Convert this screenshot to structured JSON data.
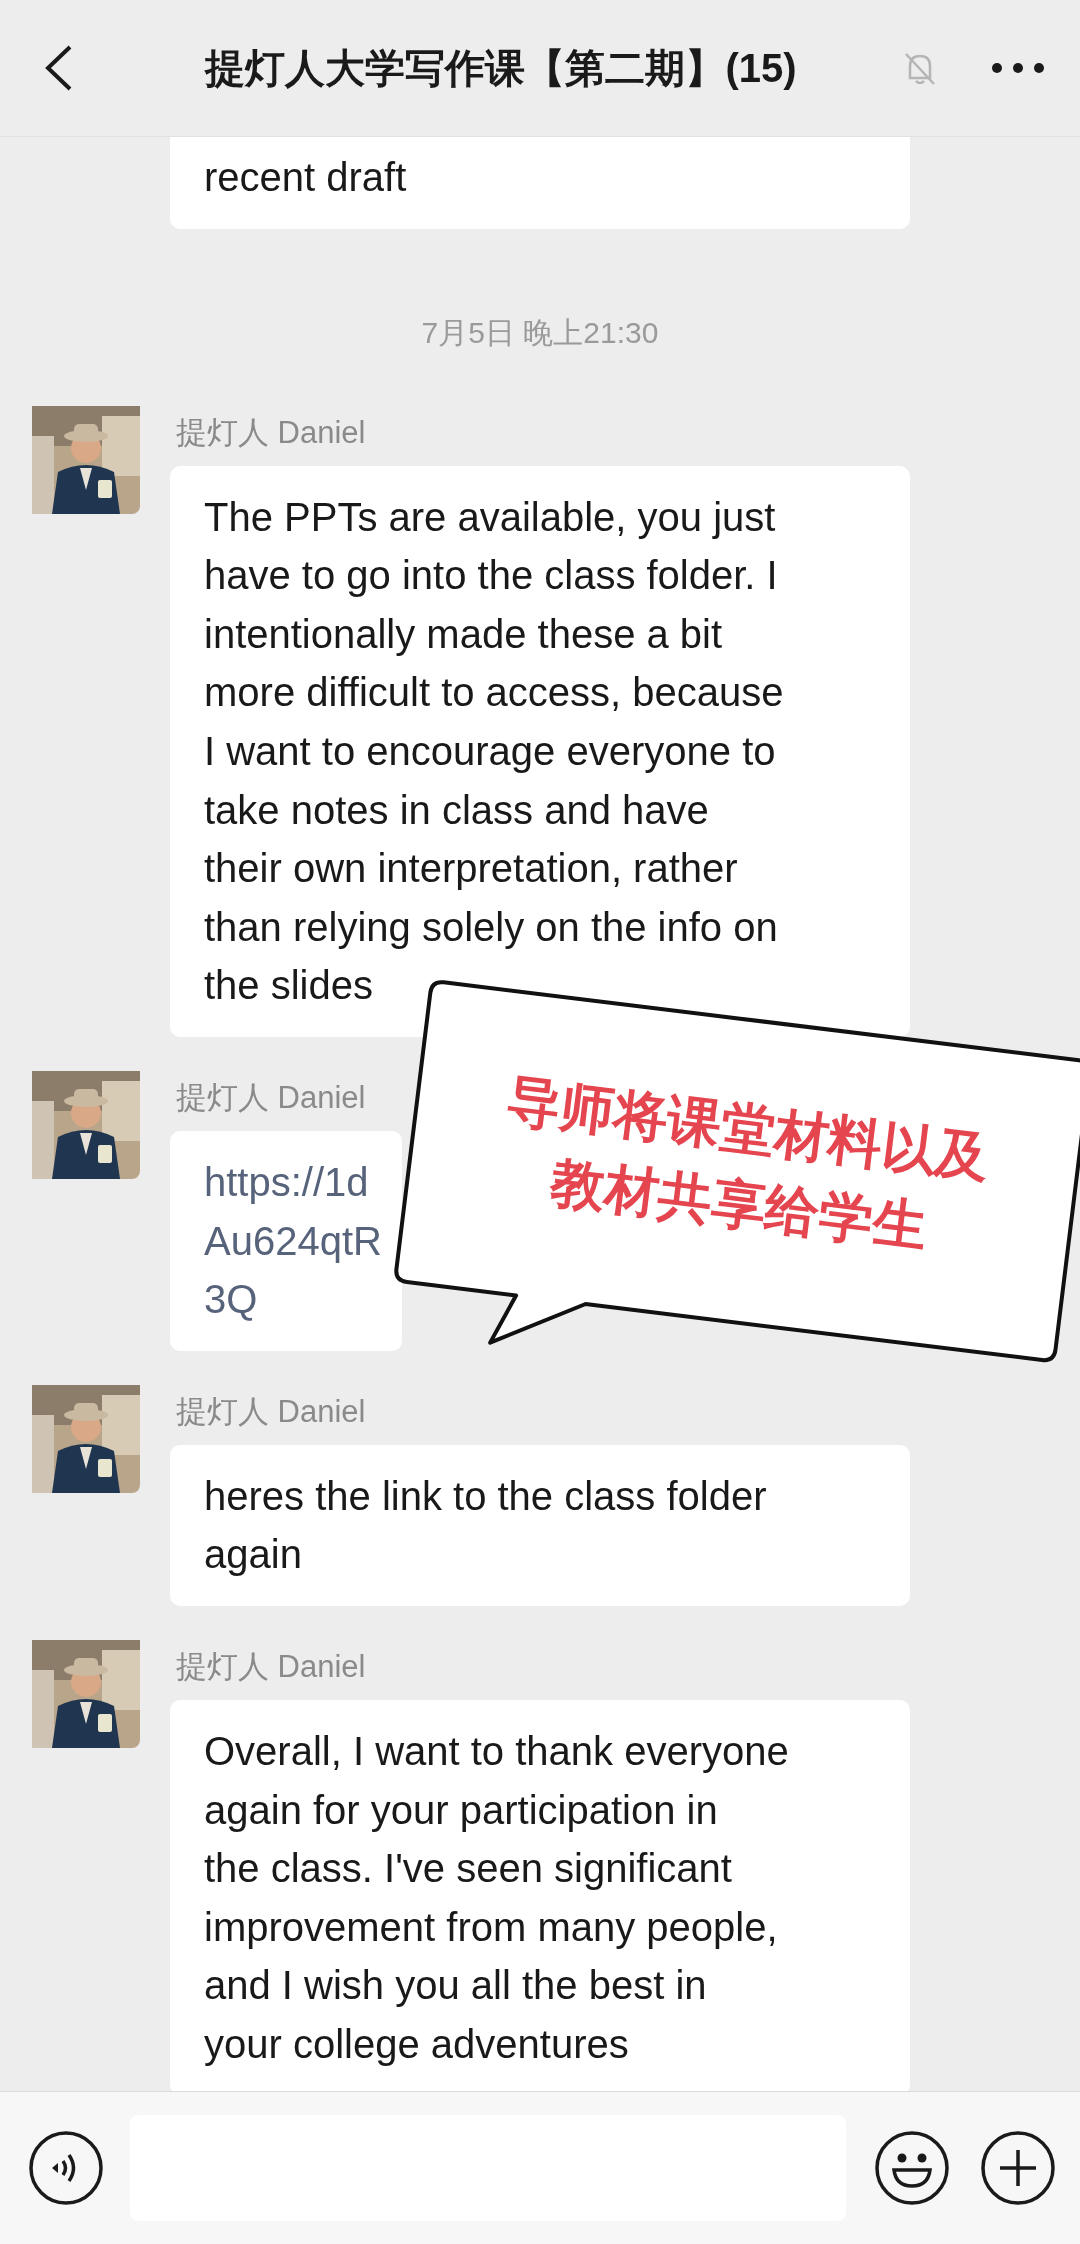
{
  "header": {
    "title": "提灯人大学写作课【第二期】(15)",
    "muted": true
  },
  "messages": [
    {
      "kind": "cut",
      "lines": [
        "recent draft"
      ]
    },
    {
      "kind": "time",
      "lines": [
        "7月5日 晚上21:30"
      ]
    },
    {
      "kind": "text",
      "sender": "提灯人 Daniel",
      "lines": [
        "The PPTs are available, you just",
        "have to go into the class folder. I",
        "intentionally made these a bit",
        "more difficult to access, because",
        "I want to encourage everyone to",
        "take notes in class and have",
        "their own interpretation, rather",
        "than relying solely on the info on",
        "the slides"
      ]
    },
    {
      "kind": "link",
      "sender": "提灯人 Daniel",
      "lines": [
        "https://1d",
        "Au624qtR",
        "3Q"
      ]
    },
    {
      "kind": "text",
      "sender": "提灯人 Daniel",
      "lines": [
        "heres the link to the class folder",
        "again"
      ]
    },
    {
      "kind": "text",
      "sender": "提灯人 Daniel",
      "lines": [
        "Overall, I want to thank everyone",
        "again for your participation in",
        "the class. I've seen significant",
        "improvement from many people,",
        "and I wish you all the best in",
        "your college adventures"
      ]
    }
  ],
  "annotation": {
    "lines": [
      "导师将课堂材料以及",
      "教材共享给学生"
    ]
  }
}
